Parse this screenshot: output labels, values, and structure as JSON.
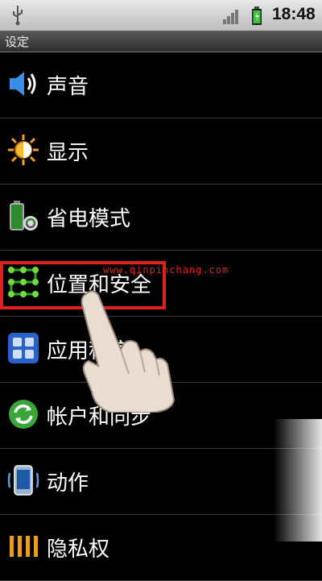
{
  "status": {
    "time": "18:48"
  },
  "title": "设定",
  "items": [
    {
      "label": "声音",
      "icon": "speaker-icon"
    },
    {
      "label": "显示",
      "icon": "brightness-icon"
    },
    {
      "label": "省电模式",
      "icon": "battery-recycle-icon"
    },
    {
      "label": "位置和安全",
      "icon": "pattern-lock-icon"
    },
    {
      "label": "应用程序",
      "icon": "apps-grid-icon"
    },
    {
      "label": "帐户和同步",
      "icon": "sync-icon"
    },
    {
      "label": "动作",
      "icon": "phone-motion-icon"
    },
    {
      "label": "隐私权",
      "icon": "privacy-icon"
    }
  ],
  "watermark": "www.qinpinchang.com",
  "colors": {
    "highlight": "#e02020",
    "title_bar": "#3a3a3a",
    "status_bar": "#d0d0d0"
  }
}
